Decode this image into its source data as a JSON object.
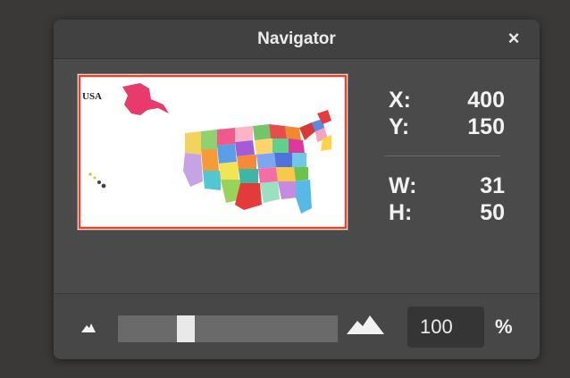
{
  "panel": {
    "title": "Navigator",
    "close_label": "×"
  },
  "thumbnail": {
    "caption": "USA",
    "frame_color": "#e0452b"
  },
  "readout": {
    "x_label": "X:",
    "x_value": "400",
    "y_label": "Y:",
    "y_value": "150",
    "w_label": "W:",
    "w_value": "31",
    "h_label": "H:",
    "h_value": "50"
  },
  "zoom": {
    "value": "100",
    "unit": "%",
    "slider_level": 0.29,
    "zoom_out_icon": "small-mountain-icon",
    "zoom_in_icon": "large-mountain-icon"
  }
}
